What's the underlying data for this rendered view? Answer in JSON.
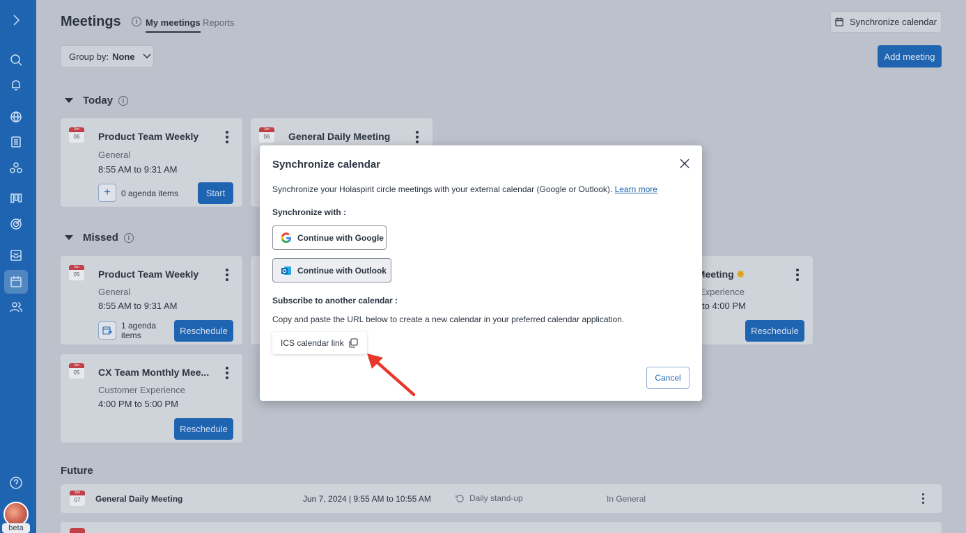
{
  "header": {
    "title": "Meetings",
    "tabs": [
      {
        "label": "My meetings",
        "active": true
      },
      {
        "label": "Reports",
        "active": false
      }
    ],
    "sync_button": "Synchronize calendar",
    "group_by_label": "Group by:",
    "group_by_value": "None",
    "add_meeting": "Add meeting"
  },
  "sidebar": {
    "icons": [
      "chevron-right-icon",
      "search-icon",
      "bell-icon",
      "globe-icon",
      "document-icon",
      "circles-icon",
      "board-icon",
      "target-icon",
      "inbox-icon",
      "calendar-icon",
      "people-icon",
      "help-icon"
    ],
    "active": "calendar-icon",
    "beta": "beta"
  },
  "sections": {
    "today": "Today",
    "missed": "Missed",
    "future": "Future"
  },
  "today_cards": [
    {
      "month": "Jun",
      "day": "06",
      "title": "Product Team Weekly",
      "circle": "General",
      "time": "8:55 AM to 9:31 AM",
      "agenda": "0 agenda items",
      "action": "Start"
    },
    {
      "month": "Jun",
      "day": "06",
      "title": "General Daily Meeting"
    }
  ],
  "missed_cards": [
    {
      "month": "Jun",
      "day": "05",
      "title": "Product Team Weekly",
      "circle": "General",
      "time": "8:55 AM to 9:31 AM",
      "agenda": "1 agenda items",
      "action": "Reschedule"
    },
    {
      "month": "Jun",
      "day": "05",
      "title": "CX Team Monthly Mee...",
      "circle": "Customer Experience",
      "time": "4:00 PM to 5:00 PM",
      "action": "Reschedule"
    }
  ],
  "partial_card": {
    "title": "w Meeting",
    "circle": "r Experience",
    "time": "to 4:00 PM",
    "action": "Reschedule"
  },
  "future_rows": [
    {
      "month": "Jun",
      "day": "07",
      "title": "General Daily Meeting",
      "date": "Jun 7, 2024 | 9:55 AM to 10:55 AM",
      "recurrence": "Daily stand-up",
      "circle": "In General"
    }
  ],
  "modal": {
    "title": "Synchronize calendar",
    "description": "Synchronize your Holaspirit circle meetings with your external calendar (Google or Outlook).",
    "learn_more": "Learn more",
    "sync_with": "Synchronize with :",
    "google": "Continue with Google",
    "outlook": "Continue with Outlook",
    "subscribe": "Subscribe to another calendar :",
    "copy_text": "Copy and paste the URL below to create a new calendar in your preferred calendar application.",
    "ics_link": "ICS calendar link",
    "cancel": "Cancel"
  },
  "colors": {
    "brand": "#1f64b0",
    "calendar_red": "#c24048",
    "arrow": "#e8372b"
  }
}
